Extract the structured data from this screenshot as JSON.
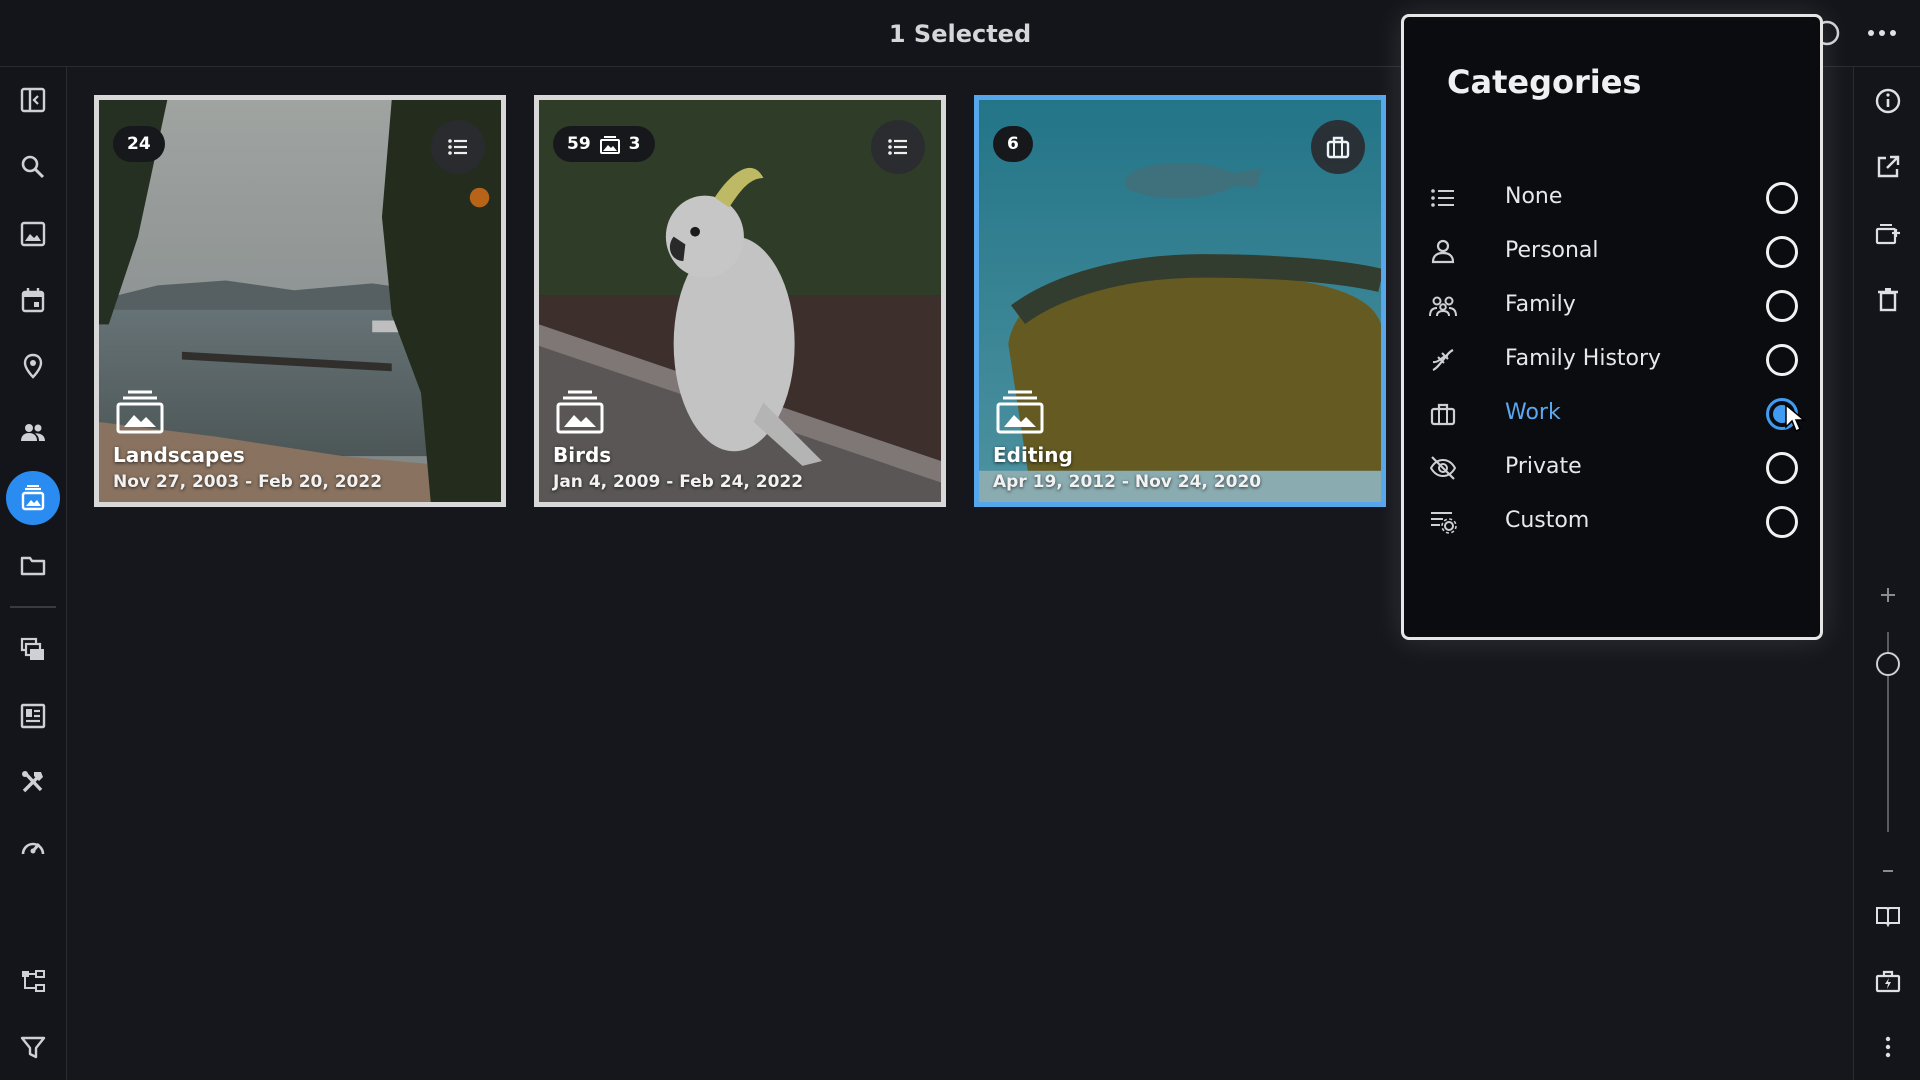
{
  "header": {
    "title": "1 Selected"
  },
  "nav": {
    "items": [
      {
        "name": "sidebar-toggle",
        "icon": "sidebar-toggle-icon"
      },
      {
        "name": "search",
        "icon": "search-icon"
      },
      {
        "name": "photos",
        "icon": "image-icon"
      },
      {
        "name": "calendar",
        "icon": "calendar-icon"
      },
      {
        "name": "places",
        "icon": "map-pin-icon"
      },
      {
        "name": "people",
        "icon": "people-icon"
      },
      {
        "name": "albums",
        "icon": "album-icon"
      },
      {
        "name": "folders",
        "icon": "folder-icon"
      },
      {
        "name": "slideshow",
        "icon": "collections-icon"
      },
      {
        "name": "layouts",
        "icon": "dashboard-icon"
      },
      {
        "name": "tools",
        "icon": "tools-icon"
      },
      {
        "name": "stats",
        "icon": "speedometer-icon"
      },
      {
        "name": "hierarchy",
        "icon": "hierarchy-icon"
      },
      {
        "name": "filter",
        "icon": "filter-icon"
      }
    ]
  },
  "albums": [
    {
      "name": "Landscapes",
      "dates": "Nov 27, 2003 - Feb 20, 2022",
      "count": "24",
      "sub_count": "",
      "category_icon": "list-icon",
      "selected": false
    },
    {
      "name": "Birds",
      "dates": "Jan 4, 2009 - Feb 24, 2022",
      "count": "59",
      "sub_count": "3",
      "category_icon": "list-icon",
      "selected": false
    },
    {
      "name": "Editing",
      "dates": "Apr 19, 2012 - Nov 24, 2020",
      "count": "6",
      "sub_count": "",
      "category_icon": "briefcase-icon",
      "selected": true
    }
  ],
  "categories_popup": {
    "title": "Categories",
    "options": [
      {
        "label": "None",
        "icon": "list-icon",
        "checked": false
      },
      {
        "label": "Personal",
        "icon": "person-icon",
        "checked": false
      },
      {
        "label": "Family",
        "icon": "family-icon",
        "checked": false
      },
      {
        "label": "Family History",
        "icon": "dna-icon",
        "checked": false
      },
      {
        "label": "Work",
        "icon": "briefcase-icon",
        "checked": true
      },
      {
        "label": "Private",
        "icon": "eye-off-icon",
        "checked": false
      },
      {
        "label": "Custom",
        "icon": "custom-settings-icon",
        "checked": false
      }
    ]
  },
  "colors": {
    "accent": "#2a8cf0",
    "selected_border": "#56a6ec",
    "background": "#16171d"
  }
}
